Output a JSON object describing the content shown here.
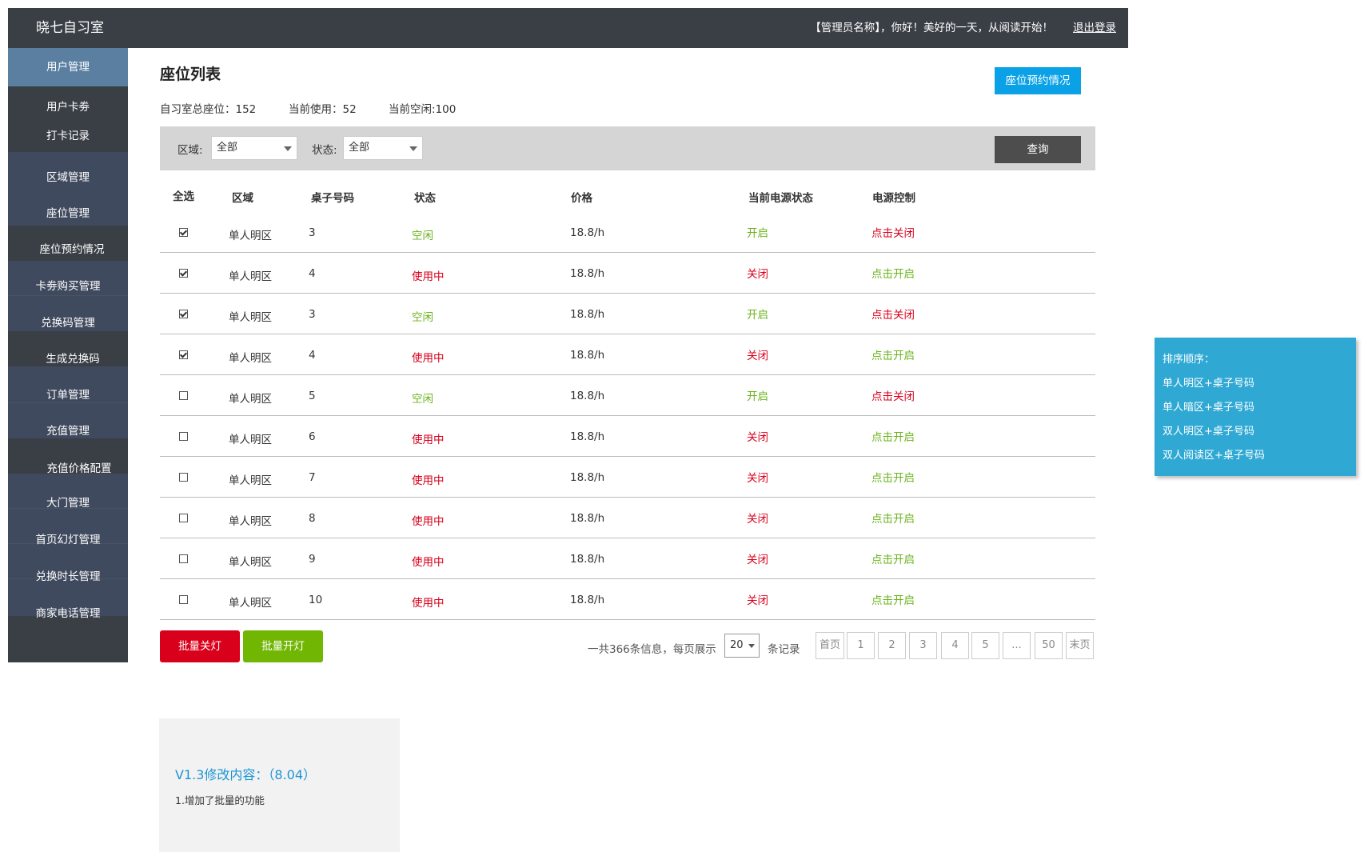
{
  "header": {
    "brand": "晓七自习室",
    "welcome": "【管理员名称】，你好！美好的一天，从阅读开始！",
    "logout": "退出登录"
  },
  "sidebar": {
    "items": [
      {
        "label": "用户管理"
      },
      {
        "label": "用户卡劵"
      },
      {
        "label": "打卡记录"
      },
      {
        "label": "区域管理"
      },
      {
        "label": "座位管理"
      },
      {
        "label": "座位预约情况"
      },
      {
        "label": "卡劵购买管理"
      },
      {
        "label": "兑换码管理"
      },
      {
        "label": "生成兑换码"
      },
      {
        "label": "订单管理"
      },
      {
        "label": "充值管理"
      },
      {
        "label": "充值价格配置"
      },
      {
        "label": "大门管理"
      },
      {
        "label": "首页幻灯管理"
      },
      {
        "label": "兑换时长管理"
      },
      {
        "label": "商家电话管理"
      }
    ],
    "colors": {
      "active": "#5a7fa1",
      "dark": "#3a3f46",
      "blue": "#404a5e"
    }
  },
  "page": {
    "title": "座位列表",
    "reserve_button": "座位预约情况",
    "stats": {
      "total": "自习室总座位：152",
      "in_use": "当前使用：52",
      "free": "当前空闲:100"
    }
  },
  "filter": {
    "region_label": "区域:",
    "region_value": "全部",
    "status_label": "状态:",
    "status_value": "全部",
    "query_button": "查询"
  },
  "table": {
    "headers": {
      "select_all": "全选",
      "region": "区域",
      "desk": "桌子号码",
      "status": "状态",
      "price": "价格",
      "power_state": "当前电源状态",
      "power_control": "电源控制"
    },
    "rows": [
      {
        "checked": true,
        "region": "单人明区",
        "desk": "3",
        "status": "空闲",
        "price": "18.8/h",
        "power": "开启",
        "action": "点击关闭"
      },
      {
        "checked": true,
        "region": "单人明区",
        "desk": "4",
        "status": "使用中",
        "price": "18.8/h",
        "power": "关闭",
        "action": "点击开启"
      },
      {
        "checked": true,
        "region": "单人明区",
        "desk": "3",
        "status": "空闲",
        "price": "18.8/h",
        "power": "开启",
        "action": "点击关闭"
      },
      {
        "checked": true,
        "region": "单人明区",
        "desk": "4",
        "status": "使用中",
        "price": "18.8/h",
        "power": "关闭",
        "action": "点击开启"
      },
      {
        "checked": false,
        "region": "单人明区",
        "desk": "5",
        "status": "空闲",
        "price": "18.8/h",
        "power": "开启",
        "action": "点击关闭"
      },
      {
        "checked": false,
        "region": "单人明区",
        "desk": "6",
        "status": "使用中",
        "price": "18.8/h",
        "power": "关闭",
        "action": "点击开启"
      },
      {
        "checked": false,
        "region": "单人明区",
        "desk": "7",
        "status": "使用中",
        "price": "18.8/h",
        "power": "关闭",
        "action": "点击开启"
      },
      {
        "checked": false,
        "region": "单人明区",
        "desk": "8",
        "status": "使用中",
        "price": "18.8/h",
        "power": "关闭",
        "action": "点击开启"
      },
      {
        "checked": false,
        "region": "单人明区",
        "desk": "9",
        "status": "使用中",
        "price": "18.8/h",
        "power": "关闭",
        "action": "点击开启"
      },
      {
        "checked": false,
        "region": "单人明区",
        "desk": "10",
        "status": "使用中",
        "price": "18.8/h",
        "power": "关闭",
        "action": "点击开启"
      }
    ]
  },
  "batch": {
    "off_label": "批量关灯",
    "on_label": "批量开灯",
    "off_color": "#d9001b",
    "on_color": "#70b603"
  },
  "pagination": {
    "info_prefix": "一共366条信息，每页展示",
    "page_size": "20",
    "info_suffix": "条记录",
    "pages": [
      "首页",
      "1",
      "2",
      "3",
      "4",
      "5",
      "...",
      "50",
      "末页"
    ]
  },
  "note": {
    "title": "V1.3修改内容：（8.04）",
    "text": "1.增加了批量的功能"
  },
  "sort_note": {
    "lines": [
      "排序顺序：",
      "单人明区+桌子号码",
      "单人暗区+桌子号码",
      "双人明区+桌子号码",
      "双人阅读区+桌子号码"
    ]
  }
}
